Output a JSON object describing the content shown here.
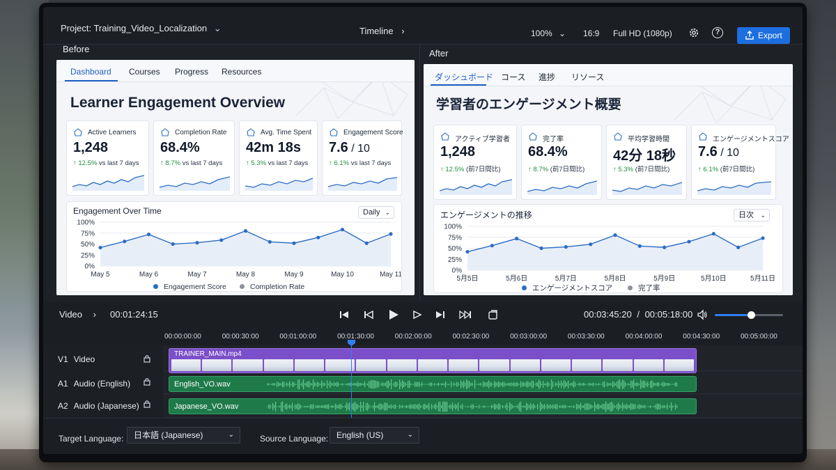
{
  "topbar": {
    "project_label": "Project:",
    "project_name": "Training_Video_Localization",
    "crumb": "Timeline",
    "zoom": "100%",
    "aspect": "16:9",
    "resolution": "Full HD (1080p)",
    "export_label": "Export"
  },
  "before": {
    "panel_label": "Before",
    "tabs": [
      "Dashboard",
      "Courses",
      "Progress",
      "Resources"
    ],
    "title": "Learner Engagement Overview",
    "kpis": [
      {
        "label": "Active Learners",
        "value": "1,248",
        "value_suffix": "",
        "change": "12.5%",
        "compare": "vs last 7 days"
      },
      {
        "label": "Completion Rate",
        "value": "68.4%",
        "value_suffix": "",
        "change": "8.7%",
        "compare": "vs last 7 days"
      },
      {
        "label": "Avg. Time Spent",
        "value": "42m 18s",
        "value_suffix": "",
        "change": "5.3%",
        "compare": "vs last 7 days"
      },
      {
        "label": "Engagement Score",
        "value": "7.6",
        "value_suffix": " / 10",
        "change": "6.1%",
        "compare": "vs last 7 days"
      }
    ],
    "chart_title": "Engagement Over Time",
    "range_select": "Daily",
    "legend": [
      "Engagement Score",
      "Completion Rate"
    ]
  },
  "after": {
    "panel_label": "After",
    "tabs": [
      "ダッシュボード",
      "コース",
      "進捗",
      "リソース"
    ],
    "title": "学習者のエンゲージメント概要",
    "kpis": [
      {
        "label": "アクティブ学習者",
        "value": "1,248",
        "value_suffix": "",
        "change": "12.5%",
        "compare": "(前7日間比)"
      },
      {
        "label": "完了率",
        "value": "68.4%",
        "value_suffix": "",
        "change": "8.7%",
        "compare": "(前7日間比)"
      },
      {
        "label": "平均学習時間",
        "value": "42分 18秒",
        "value_suffix": "",
        "change": "5.3%",
        "compare": "(前7日間比)"
      },
      {
        "label": "エンゲージメントスコア",
        "value": "7.6",
        "value_suffix": " / 10",
        "change": "6.1%",
        "compare": "(前7日間比)"
      }
    ],
    "chart_title": "エンゲージメントの推移",
    "range_select": "日次",
    "legend": [
      "エンゲージメントスコア",
      "完了率"
    ]
  },
  "chart_data": [
    {
      "type": "line",
      "title": "Engagement Over Time",
      "categories": [
        "May 5",
        "May 6",
        "May 7",
        "May 8",
        "May 9",
        "May 10",
        "May 11"
      ],
      "yticks": [
        "100%",
        "75%",
        "50%",
        "25%",
        "0%"
      ],
      "ylim": [
        0,
        100
      ],
      "grid": true,
      "legend_position": "bottom",
      "series": [
        {
          "name": "Engagement Score",
          "color": "#2b6cc4",
          "x": [
            0,
            0.5,
            1,
            1.5,
            2,
            2.5,
            3,
            3.5,
            4,
            4.5,
            5,
            5.5,
            6
          ],
          "values": [
            42,
            56,
            72,
            50,
            53,
            59,
            80,
            55,
            52,
            65,
            83,
            52,
            73
          ]
        },
        {
          "name": "Completion Rate",
          "color": "#8d939c",
          "values": []
        }
      ]
    },
    {
      "type": "line",
      "title": "エンゲージメントの推移",
      "categories": [
        "5月5日",
        "5月6日",
        "5月7日",
        "5月8日",
        "5月9日",
        "5月10日",
        "5月11日"
      ],
      "yticks": [
        "100%",
        "75%",
        "50%",
        "25%",
        "0%"
      ],
      "ylim": [
        0,
        100
      ],
      "grid": true,
      "legend_position": "bottom",
      "series": [
        {
          "name": "エンゲージメントスコア",
          "color": "#2b6cc4",
          "x": [
            0,
            0.5,
            1,
            1.5,
            2,
            2.5,
            3,
            3.5,
            4,
            4.5,
            5,
            5.5,
            6
          ],
          "values": [
            42,
            56,
            72,
            50,
            53,
            59,
            80,
            55,
            52,
            65,
            83,
            52,
            73
          ]
        },
        {
          "name": "完了率",
          "color": "#8d939c",
          "values": []
        }
      ]
    }
  ],
  "transport": {
    "section": "Video",
    "current": "00:01:24:15",
    "position": "00:03:45:20",
    "separator": "/",
    "duration": "00:05:18:00",
    "volume": 0.55
  },
  "ruler": [
    "00:00:00:00",
    "00:00:30:00",
    "00:01:00:00",
    "00:01:30:00",
    "00:02:00:00",
    "00:02:30:00",
    "00:03:00:00",
    "00:03:30:00",
    "00:04:00:00",
    "00:04:30:00",
    "00:05:00:00"
  ],
  "tracks": [
    {
      "id": "V1",
      "name": "Video",
      "clip": "TRAINER_MAIN.mp4"
    },
    {
      "id": "A1",
      "name": "Audio (English)",
      "clip": "English_VO.wav"
    },
    {
      "id": "A2",
      "name": "Audio (Japanese)",
      "clip": "Japanese_VO.wav"
    }
  ],
  "footer": {
    "target_label": "Target Language:",
    "target_value": "日本語 (Japanese)",
    "source_label": "Source Language:",
    "source_value": "English (US)"
  },
  "colors": {
    "accent": "#1d6fe0",
    "video_clip": "#7b4fc9",
    "audio_clip": "#1f7a4a",
    "positive": "#1e8e3e"
  },
  "icons": [
    "chevron-down-icon",
    "chevron-right-icon",
    "gear-icon",
    "help-icon",
    "export-icon",
    "kpi-icon",
    "skip-start-icon",
    "step-back-icon",
    "play-icon",
    "step-forward-icon",
    "skip-end-icon",
    "fast-forward-icon",
    "loop-icon",
    "volume-icon",
    "lock-icon"
  ]
}
